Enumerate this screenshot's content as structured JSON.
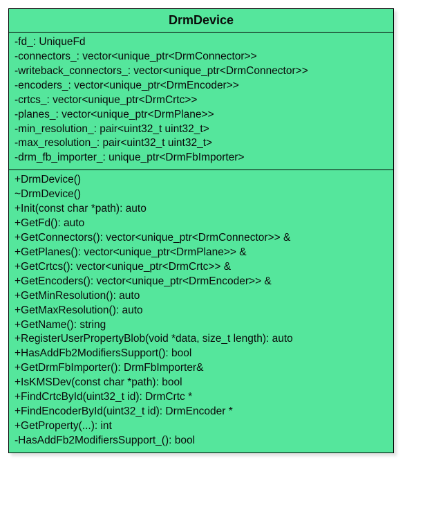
{
  "class_name": "DrmDevice",
  "attributes": [
    "-fd_: UniqueFd",
    "-connectors_: vector<unique_ptr<DrmConnector>>",
    "-writeback_connectors_: vector<unique_ptr<DrmConnector>>",
    "-encoders_: vector<unique_ptr<DrmEncoder>>",
    "-crtcs_: vector<unique_ptr<DrmCrtc>>",
    "-planes_: vector<unique_ptr<DrmPlane>>",
    "-min_resolution_: pair<uint32_t  uint32_t>",
    "-max_resolution_: pair<uint32_t  uint32_t>",
    "-drm_fb_importer_: unique_ptr<DrmFbImporter>"
  ],
  "methods": [
    "+DrmDevice()",
    "~DrmDevice()",
    "+Init(const char *path): auto",
    "+GetFd(): auto",
    "+GetConnectors(): vector<unique_ptr<DrmConnector>> &",
    "+GetPlanes(): vector<unique_ptr<DrmPlane>> &",
    "+GetCrtcs(): vector<unique_ptr<DrmCrtc>> &",
    "+GetEncoders(): vector<unique_ptr<DrmEncoder>> &",
    "+GetMinResolution(): auto",
    "+GetMaxResolution(): auto",
    "+GetName(): string",
    "+RegisterUserPropertyBlob(void *data, size_t length): auto",
    "+HasAddFb2ModifiersSupport(): bool",
    "+GetDrmFbImporter(): DrmFbImporter&",
    "+IsKMSDev(const char *path): bool",
    "+FindCrtcById(uint32_t id): DrmCrtc *",
    "+FindEncoderById(uint32_t id): DrmEncoder *",
    "+GetProperty(...): int",
    "-HasAddFb2ModifiersSupport_(): bool"
  ]
}
